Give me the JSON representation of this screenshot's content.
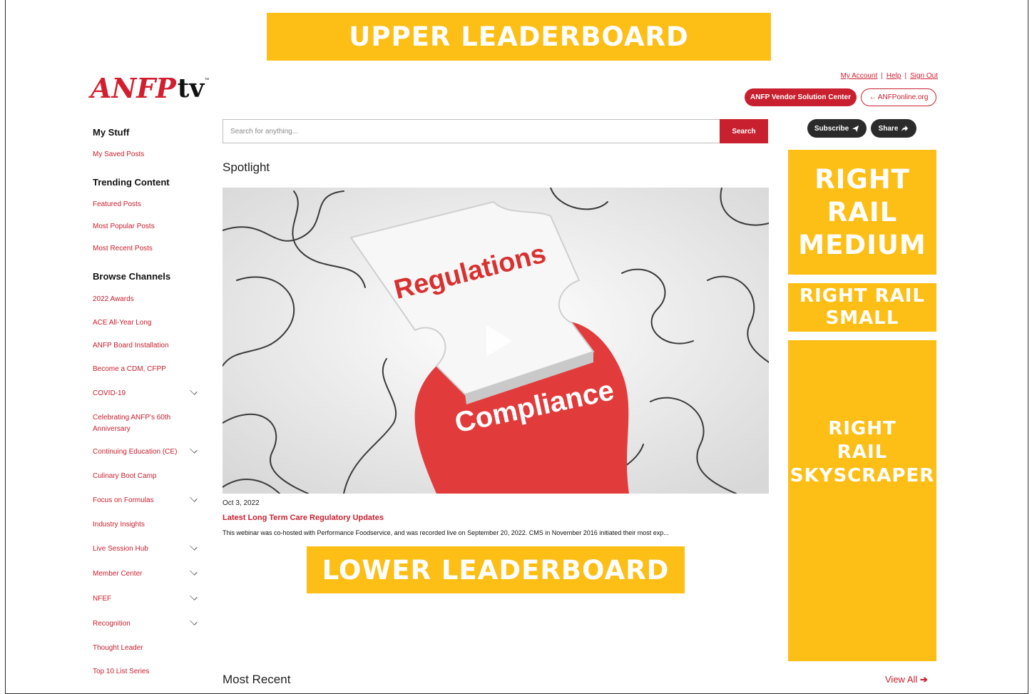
{
  "ads": {
    "upper": "UPPER LEADERBOARD",
    "lower": "LOWER LEADERBOARD",
    "right_medium": "RIGHT\nRAIL\nMEDIUM",
    "right_small": "RIGHT RAIL\nSMALL",
    "right_sky": "RIGHT\nRAIL\nSKYSCRAPER",
    "color": "#fdbf16"
  },
  "brand": {
    "logo_a": "ANFP",
    "logo_b": "tv",
    "tm": "™",
    "accent": "#c8202f"
  },
  "header": {
    "links": {
      "account": "My Account",
      "help": "Help",
      "signout": "Sign Out",
      "sep": "|"
    },
    "vendor_btn": "ANFP Vendor Solution Center",
    "anfp_btn": "← ANFPonline.org",
    "subscribe_btn": "Subscribe",
    "share_btn": "Share"
  },
  "search": {
    "placeholder": "Search for anything...",
    "button": "Search"
  },
  "sidebar": {
    "my_stuff_title": "My Stuff",
    "saved_posts": "My Saved Posts",
    "trending_title": "Trending Content",
    "trending": [
      "Featured Posts",
      "Most Popular Posts",
      "Most Recent Posts"
    ],
    "browse_title": "Browse Channels",
    "channels": [
      "2022 Awards",
      "ACE All-Year Long",
      "ANFP Board Installation",
      "Become a CDM, CFPP",
      "COVID-19",
      "Celebrating ANFP's 60th",
      "Anniversary",
      "Continuing Education (CE)",
      "Culinary Boot Camp",
      "Focus on Formulas",
      "Industry Insights",
      "Live Session Hub",
      "Member Center",
      "NFEF",
      "Recognition",
      "Thought Leader",
      "Top 10 List Series"
    ]
  },
  "main": {
    "spotlight_title": "Spotlight",
    "video_text": {
      "top": "Regulations",
      "bottom": "Compliance"
    },
    "post": {
      "date": "Oct 3, 2022",
      "title": "Latest Long Term Care Regulatory Updates",
      "excerpt": "This webinar was co-hosted with Performance Foodservice, and was recorded live on September 20, 2022. CMS in November 2016 initiated their most exp..."
    },
    "most_recent_title": "Most Recent",
    "view_all": "View All"
  }
}
